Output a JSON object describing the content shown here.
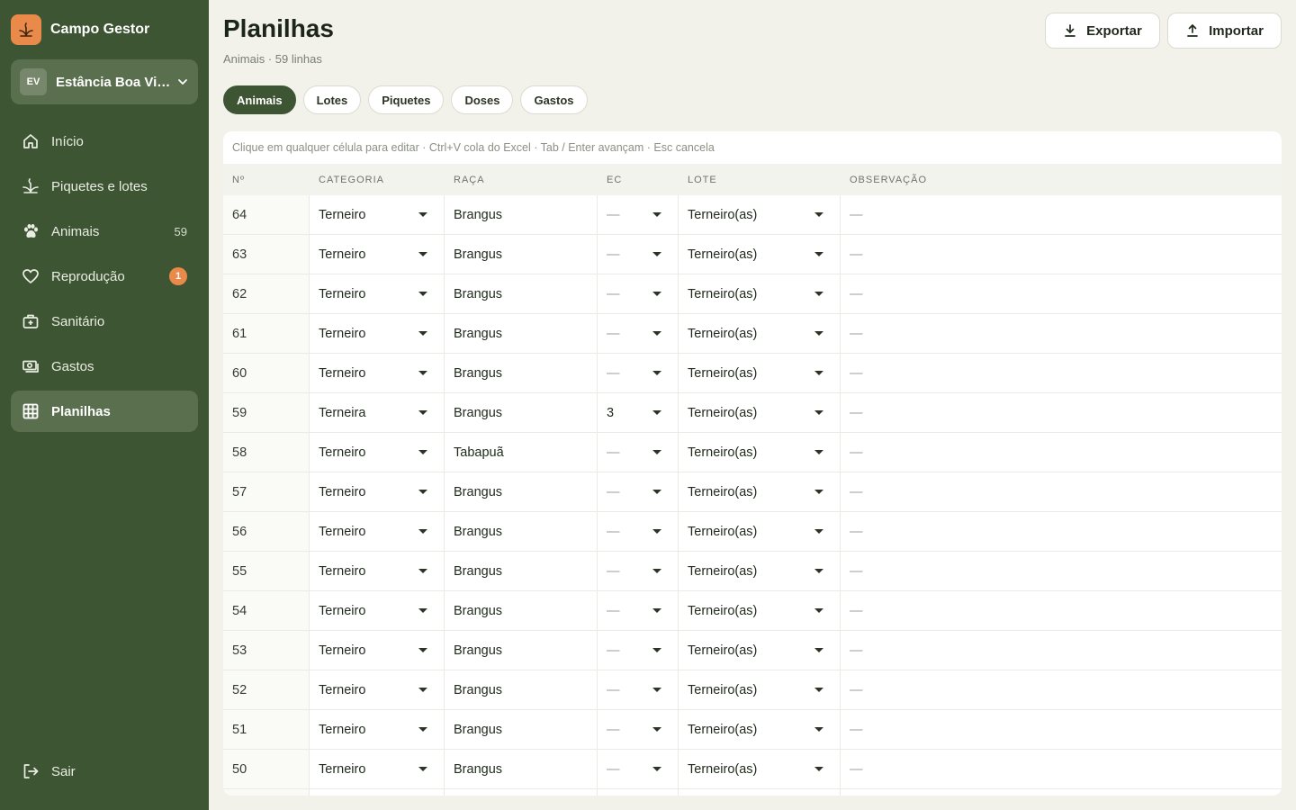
{
  "app": {
    "name": "Campo Gestor"
  },
  "farm": {
    "initials": "EV",
    "name": "Estância Boa Vista"
  },
  "nav": [
    {
      "label": "Início",
      "icon": "home-icon"
    },
    {
      "label": "Piquetes e lotes",
      "icon": "sprout-icon"
    },
    {
      "label": "Animais",
      "icon": "paw-icon",
      "count": "59"
    },
    {
      "label": "Reprodução",
      "icon": "heart-icon",
      "badge": "1"
    },
    {
      "label": "Sanitário",
      "icon": "medical-kit-icon"
    },
    {
      "label": "Gastos",
      "icon": "money-icon"
    },
    {
      "label": "Planilhas",
      "icon": "grid-icon",
      "active": true
    }
  ],
  "logout": {
    "label": "Sair"
  },
  "page": {
    "title": "Planilhas",
    "subtitle": "Animais · 59 linhas"
  },
  "actions": {
    "export_label": "Exportar",
    "import_label": "Importar"
  },
  "tabs": [
    {
      "label": "Animais",
      "active": true
    },
    {
      "label": "Lotes"
    },
    {
      "label": "Piquetes"
    },
    {
      "label": "Doses"
    },
    {
      "label": "Gastos"
    }
  ],
  "sheet": {
    "hint": "Clique em qualquer célula para editar · Ctrl+V cola do Excel · Tab / Enter avançam · Esc cancela",
    "columns": [
      "Nº",
      "Categoria",
      "Raça",
      "EC",
      "Lote",
      "Observação"
    ],
    "rows": [
      {
        "num": "64",
        "categoria": "Terneiro",
        "raca": "Brangus",
        "ec": "—",
        "lote": "Terneiro(as)",
        "obs": "—"
      },
      {
        "num": "63",
        "categoria": "Terneiro",
        "raca": "Brangus",
        "ec": "—",
        "lote": "Terneiro(as)",
        "obs": "—"
      },
      {
        "num": "62",
        "categoria": "Terneiro",
        "raca": "Brangus",
        "ec": "—",
        "lote": "Terneiro(as)",
        "obs": "—"
      },
      {
        "num": "61",
        "categoria": "Terneiro",
        "raca": "Brangus",
        "ec": "—",
        "lote": "Terneiro(as)",
        "obs": "—"
      },
      {
        "num": "60",
        "categoria": "Terneiro",
        "raca": "Brangus",
        "ec": "—",
        "lote": "Terneiro(as)",
        "obs": "—"
      },
      {
        "num": "59",
        "categoria": "Terneira",
        "raca": "Brangus",
        "ec": "3",
        "lote": "Terneiro(as)",
        "obs": "—"
      },
      {
        "num": "58",
        "categoria": "Terneiro",
        "raca": "Tabapuã",
        "ec": "—",
        "lote": "Terneiro(as)",
        "obs": "—"
      },
      {
        "num": "57",
        "categoria": "Terneiro",
        "raca": "Brangus",
        "ec": "—",
        "lote": "Terneiro(as)",
        "obs": "—"
      },
      {
        "num": "56",
        "categoria": "Terneiro",
        "raca": "Brangus",
        "ec": "—",
        "lote": "Terneiro(as)",
        "obs": "—"
      },
      {
        "num": "55",
        "categoria": "Terneiro",
        "raca": "Brangus",
        "ec": "—",
        "lote": "Terneiro(as)",
        "obs": "—"
      },
      {
        "num": "54",
        "categoria": "Terneiro",
        "raca": "Brangus",
        "ec": "—",
        "lote": "Terneiro(as)",
        "obs": "—"
      },
      {
        "num": "53",
        "categoria": "Terneiro",
        "raca": "Brangus",
        "ec": "—",
        "lote": "Terneiro(as)",
        "obs": "—"
      },
      {
        "num": "52",
        "categoria": "Terneiro",
        "raca": "Brangus",
        "ec": "—",
        "lote": "Terneiro(as)",
        "obs": "—"
      },
      {
        "num": "51",
        "categoria": "Terneiro",
        "raca": "Brangus",
        "ec": "—",
        "lote": "Terneiro(as)",
        "obs": "—"
      },
      {
        "num": "50",
        "categoria": "Terneiro",
        "raca": "Brangus",
        "ec": "—",
        "lote": "Terneiro(as)",
        "obs": "—"
      },
      {
        "num": "",
        "categoria": "",
        "raca": "",
        "ec": "",
        "lote": "",
        "obs": ""
      }
    ]
  },
  "colors": {
    "sidebar": "#3d5532",
    "accent": "#e98a4a",
    "background": "#f3f2ea"
  }
}
